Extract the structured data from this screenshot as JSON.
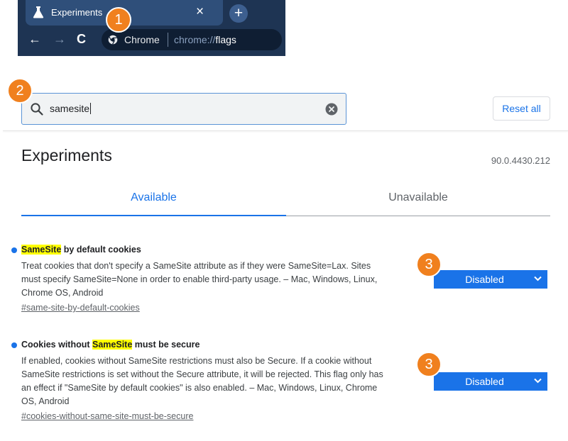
{
  "browser": {
    "tab_title": "Experiments",
    "tab_close": "×",
    "new_tab": "+",
    "nav": {
      "back": "←",
      "forward": "→",
      "reload": "C"
    },
    "omnibox": {
      "site_label": "Chrome",
      "url_scheme": "chrome://",
      "url_path": "flags"
    }
  },
  "callouts": [
    "1",
    "2",
    "3",
    "3"
  ],
  "search": {
    "value": "samesite",
    "reset_label": "Reset all"
  },
  "page": {
    "title": "Experiments",
    "version": "90.0.4430.212"
  },
  "tabs": [
    {
      "label": "Available",
      "active": true
    },
    {
      "label": "Unavailable",
      "active": false
    }
  ],
  "experiments": [
    {
      "title_pre": "",
      "title_highlight": "SameSite",
      "title_post": " by default cookies",
      "description_lines": [
        "Treat cookies that don't specify a SameSite attribute as if they were SameSite=Lax. Sites",
        "must specify SameSite=None in order to enable third-party usage. – Mac, Windows, Linux,",
        "Chrome OS, Android"
      ],
      "link": "#same-site-by-default-cookies",
      "value": "Disabled"
    },
    {
      "title_pre": "Cookies without ",
      "title_highlight": "SameSite",
      "title_post": " must be secure",
      "description_lines": [
        "If enabled, cookies without SameSite restrictions must also be Secure. If a cookie without",
        "SameSite restrictions is set without the Secure attribute, it will be rejected. This flag only has",
        "an effect if \"SameSite by default cookies\" is also enabled. – Mac, Windows, Linux, Chrome",
        "OS, Android"
      ],
      "link": "#cookies-without-same-site-must-be-secure",
      "value": "Disabled"
    }
  ],
  "colors": {
    "accent": "#1a73e8",
    "callout": "#f0801e",
    "highlight": "#ffff00",
    "browser_frame": "#1e3453"
  }
}
